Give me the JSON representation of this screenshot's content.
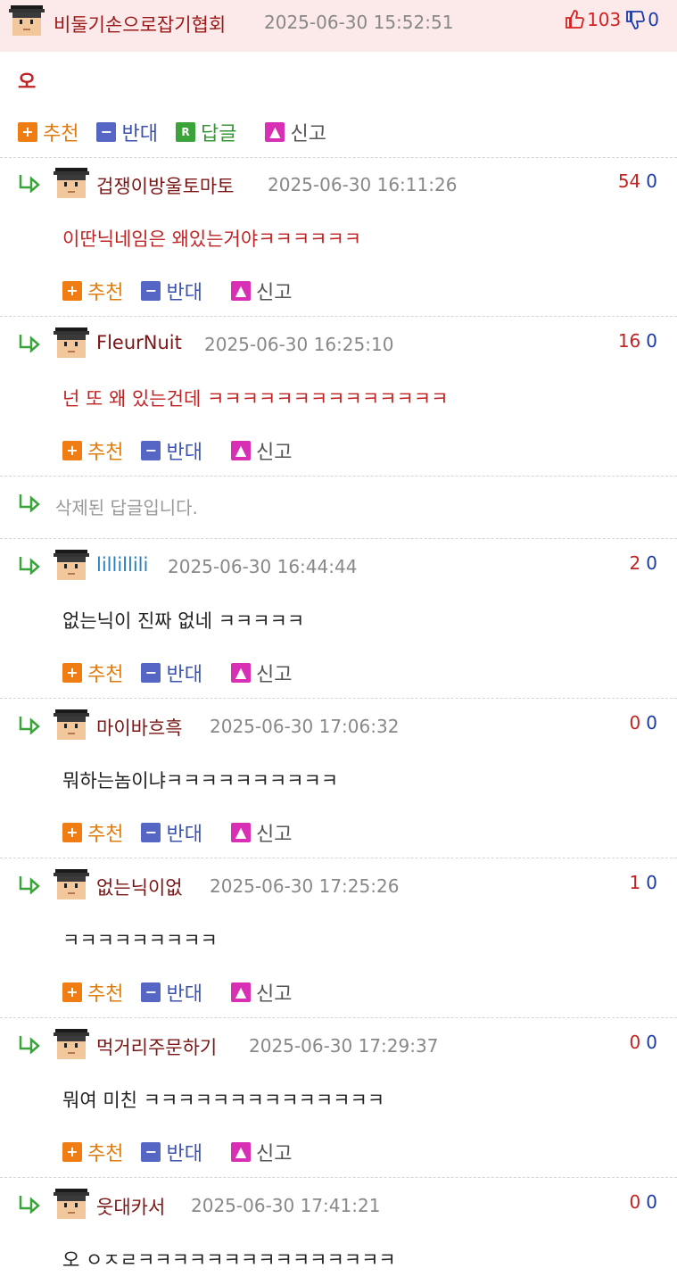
{
  "parent": {
    "nickname": "비둘기손으로잡기협회",
    "time": "2025-06-30 15:52:51",
    "up": "103",
    "down": "0",
    "body": "오",
    "actions": {
      "recommend": "추천",
      "oppose": "반대",
      "reply": "답글",
      "report": "신고"
    }
  },
  "action_labels": {
    "recommend": "추천",
    "oppose": "반대",
    "report": "신고"
  },
  "replies": [
    {
      "nickname": "겁쟁이방울토마토",
      "time": "2025-06-30 16:11:26",
      "up": "54",
      "down": "0",
      "body": "이딴닉네임은 왜있는거야ㅋㅋㅋㅋㅋㅋ"
    },
    {
      "nickname": "FleurNuit",
      "time": "2025-06-30 16:25:10",
      "up": "16",
      "down": "0",
      "body": "넌 또 왜 있는건데 ㅋㅋㅋㅋㅋㅋㅋㅋㅋㅋㅋㅋㅋㅋ"
    },
    {
      "deleted_text": "삭제된 답글입니다."
    },
    {
      "nickname": "lillillili",
      "time": "2025-06-30 16:44:44",
      "up": "2",
      "down": "0",
      "body": "없는닉이 진짜 없네 ㅋㅋㅋㅋㅋ"
    },
    {
      "nickname": "마이바흐흑",
      "time": "2025-06-30 17:06:32",
      "up": "0",
      "down": "0",
      "body": "뭐하는놈이냐ㅋㅋㅋㅋㅋㅋㅋㅋㅋㅋ"
    },
    {
      "nickname": "없는닉이없",
      "time": "2025-06-30 17:25:26",
      "up": "1",
      "down": "0",
      "body": "ㅋㅋㅋㅋㅋㅋㅋㅋㅋ"
    },
    {
      "nickname": "먹거리주문하기",
      "time": "2025-06-30 17:29:37",
      "up": "0",
      "down": "0",
      "body": "뭐여 미친 ㅋㅋㅋㅋㅋㅋㅋㅋㅋㅋㅋㅋㅋㅋ"
    },
    {
      "nickname": "웃대카서",
      "time": "2025-06-30 17:41:21",
      "up": "0",
      "down": "0",
      "body": "오 ㅇㅈㄹㅋㅋㅋㅋㅋㅋㅋㅋㅋㅋㅋㅋㅋㅋㅋ"
    }
  ],
  "colors": {
    "nickname": "#7a1616",
    "nickname_link": "#2a7fc0",
    "body_red": "#c02323",
    "body_dark": "#222222",
    "recommend": "#ef7d14",
    "oppose": "#5566c4",
    "reply": "#3aa33a",
    "report": "#d82fb5",
    "header_bg": "#fce9e9"
  }
}
